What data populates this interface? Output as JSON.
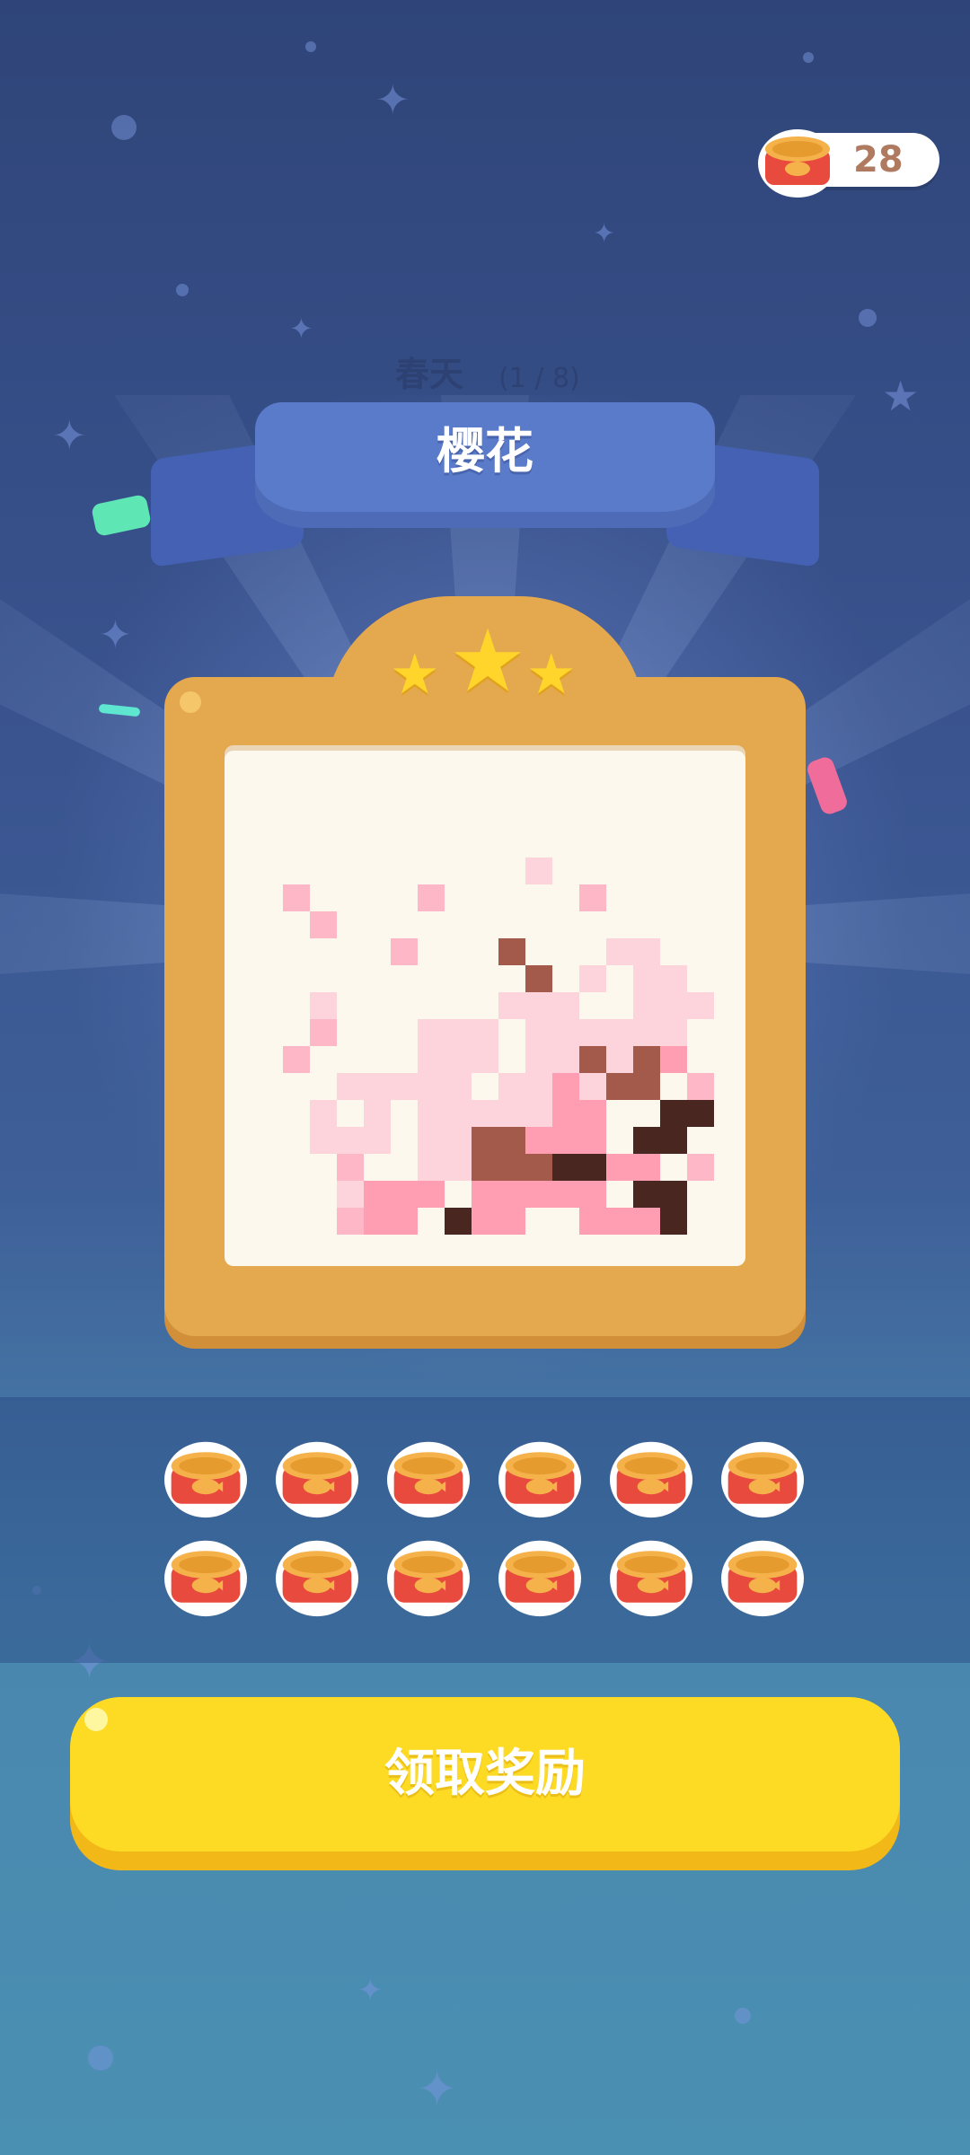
{
  "currency": {
    "icon": "tuna-can-icon",
    "count": "28"
  },
  "level": {
    "season": "春天",
    "progress": "(1 / 8)",
    "title": "樱花"
  },
  "rating": {
    "stars": 3,
    "icon": "star-icon"
  },
  "pixel_art": {
    "subject": "樱花",
    "palette": {
      "p": "#fdb7c6",
      "q": "#fdd4db",
      "r": "#ff9db3",
      "b": "#a35a4a",
      "d": "#4a2620"
    },
    "rows": [
      "...................",
      "...................",
      "...................",
      "...................",
      "...........q.......",
      "..p....p.....p.....",
      "...p...............",
      "......p...b...qq...",
      "...........b.q.qq..",
      "...q......qqq..qqq.",
      "...p...qqq.qqqqqq..",
      "..p....qqq.qqbqbr..",
      "....qqqqq.qqrqbb.p.",
      "...q.q.qqqqqrr..dd.",
      "...qqq.qqbbrrr.dd..",
      "....p..qqbbbddrr.p.",
      "....qrrr.rrrrr.dd..",
      "....prr.drr..rrrd..",
      "...................",
      "..................."
    ]
  },
  "rewards": {
    "icon": "tuna-can-icon",
    "count": 12
  },
  "claim_button": {
    "label": "领取奖励"
  },
  "colors": {
    "accent": "#fdda24",
    "frame": "#e4a84e",
    "ribbon": "#5a7bc9",
    "background": "#3a5490"
  }
}
